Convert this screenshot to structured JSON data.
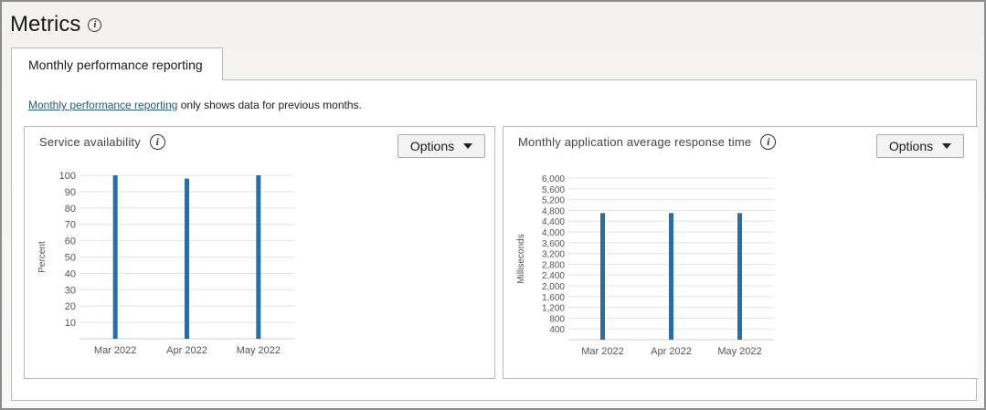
{
  "header": {
    "title": "Metrics"
  },
  "tabs": [
    {
      "label": "Monthly performance reporting"
    }
  ],
  "notice": {
    "link_text": "Monthly performance reporting",
    "text": " only shows data for previous months."
  },
  "options_label": "Options",
  "chart_data": [
    {
      "type": "bar",
      "title": "Service availability",
      "xlabel": "",
      "ylabel": "Percent",
      "categories": [
        "Mar 2022",
        "Apr 2022",
        "May 2022"
      ],
      "values": [
        100,
        98,
        100
      ],
      "yticks": [
        10,
        20,
        30,
        40,
        50,
        60,
        70,
        80,
        90,
        100
      ],
      "ylim": [
        0,
        100
      ],
      "grid": true,
      "bar_color": "#2a6ca5"
    },
    {
      "type": "bar",
      "title": "Monthly application average response time",
      "xlabel": "",
      "ylabel": "Milliseconds",
      "categories": [
        "Mar 2022",
        "Apr 2022",
        "May 2022"
      ],
      "values": [
        4700,
        4700,
        4700
      ],
      "yticks": [
        400,
        800,
        1200,
        1600,
        2000,
        2400,
        2800,
        3200,
        3600,
        4000,
        4400,
        4800,
        5200,
        5600,
        6000
      ],
      "ylim": [
        0,
        6000
      ],
      "grid": true,
      "bar_color": "#2a6ca5"
    }
  ]
}
